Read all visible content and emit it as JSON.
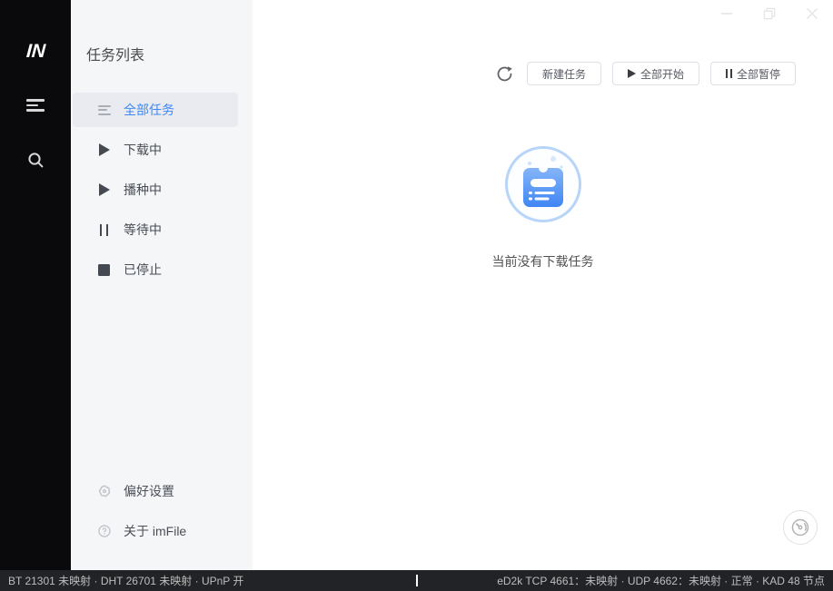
{
  "app_rail": {
    "logo": "IN",
    "icons": [
      "task-menu-icon",
      "search-icon"
    ]
  },
  "sidebar": {
    "title": "任务列表",
    "items": [
      {
        "label": "全部任务",
        "icon": "list-icon",
        "active": true
      },
      {
        "label": "下载中",
        "icon": "play-icon",
        "active": false
      },
      {
        "label": "播种中",
        "icon": "play-icon",
        "active": false
      },
      {
        "label": "等待中",
        "icon": "pause-icon",
        "active": false
      },
      {
        "label": "已停止",
        "icon": "stop-icon",
        "active": false
      }
    ],
    "footer_items": [
      {
        "label": "偏好设置",
        "icon": "gear-icon"
      },
      {
        "label": "关于 imFile",
        "icon": "question-icon"
      }
    ]
  },
  "toolbar": {
    "refresh_icon": "refresh-icon",
    "buttons": [
      {
        "label": "新建任务",
        "icon": null
      },
      {
        "label": "全部开始",
        "icon": "play-icon"
      },
      {
        "label": "全部暂停",
        "icon": "pause-icon"
      }
    ]
  },
  "empty_state": {
    "icon": "task-document-icon",
    "message": "当前没有下载任务"
  },
  "window_controls": [
    "minimize-icon",
    "maximize-icon",
    "close-icon"
  ],
  "floating_button": {
    "icon": "speed-gauge-icon"
  },
  "status_bar": {
    "left": "BT 21301 未映射 · DHT 26701 未映射 · UPnP 开",
    "right": "eD2k TCP 4661：未映射 · UDP 4662：未映射 · 正常 · KAD 48 节点"
  },
  "colors": {
    "accent_blue": "#3e87f3",
    "icon_gradient_top": "#85b5f8",
    "icon_gradient_bottom": "#3f86f5",
    "icon_ring": "#b7d4f9",
    "rail_bg": "#0a0a0c",
    "sidebar_bg": "#f5f6f8",
    "selected_bg": "#e9ebf0",
    "statusbar_bg": "#212326"
  }
}
